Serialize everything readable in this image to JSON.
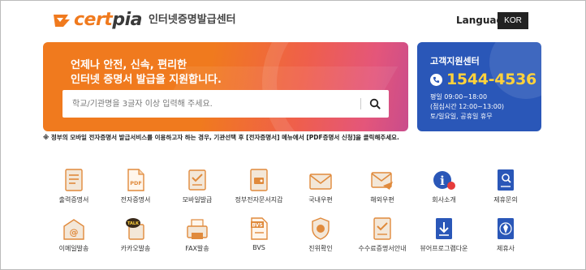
{
  "header": {
    "logo_cert": "cert",
    "logo_pia": "pia",
    "logo_subtitle": "인터넷증명발급센터",
    "language_label": "Language",
    "language_value": "KOR"
  },
  "hero": {
    "line1": "언제나 안전, 신속, 편리한",
    "line2": "인터넷 증명서 발급을 지원합니다.",
    "search_placeholder": "학교/기관명을 3글자 이상 입력해 주세요."
  },
  "support": {
    "title": "고객지원센터",
    "phone": "1544-4536",
    "hours_weekday": "평일 09:00~18:00",
    "hours_lunch": "(점심시간 12:00~13:00)",
    "hours_closed": "토/일요일, 공휴일 휴무"
  },
  "notice": "※ 정부의 모바일 전자증명서 발급서비스를 이용하고자 하는 경우, 기관선택 후 [전자증명서] 메뉴에서 [PDF증명서 신청]을 클릭해주세요.",
  "menu_row1": [
    {
      "label": "출력증명서",
      "icon": "printed-certificate-icon"
    },
    {
      "label": "전자증명서",
      "icon": "pdf-document-icon"
    },
    {
      "label": "모바일발급",
      "icon": "mobile-issue-icon"
    },
    {
      "label": "정부전자문서지갑",
      "icon": "gov-wallet-icon"
    },
    {
      "label": "국내우편",
      "icon": "domestic-mail-icon"
    },
    {
      "label": "해외우편",
      "icon": "overseas-mail-icon"
    },
    {
      "label": "회사소개",
      "icon": "company-info-icon"
    },
    {
      "label": "제휴문의",
      "icon": "partnership-icon"
    }
  ],
  "menu_row2": [
    {
      "label": "이메일발송",
      "icon": "email-icon"
    },
    {
      "label": "카카오발송",
      "icon": "kakao-talk-icon"
    },
    {
      "label": "FAX발송",
      "icon": "fax-icon"
    },
    {
      "label": "BVS",
      "icon": "bvs-icon"
    },
    {
      "label": "진위확인",
      "icon": "verify-icon"
    },
    {
      "label": "수수료증명서안내",
      "icon": "fee-guide-icon"
    },
    {
      "label": "뷰어프로그램다운",
      "icon": "viewer-download-icon"
    },
    {
      "label": "제휴사",
      "icon": "partners-icon"
    }
  ],
  "colors": {
    "brand_orange": "#f07a1e",
    "support_blue": "#2a57b8",
    "phone_yellow": "#ffd23c"
  }
}
